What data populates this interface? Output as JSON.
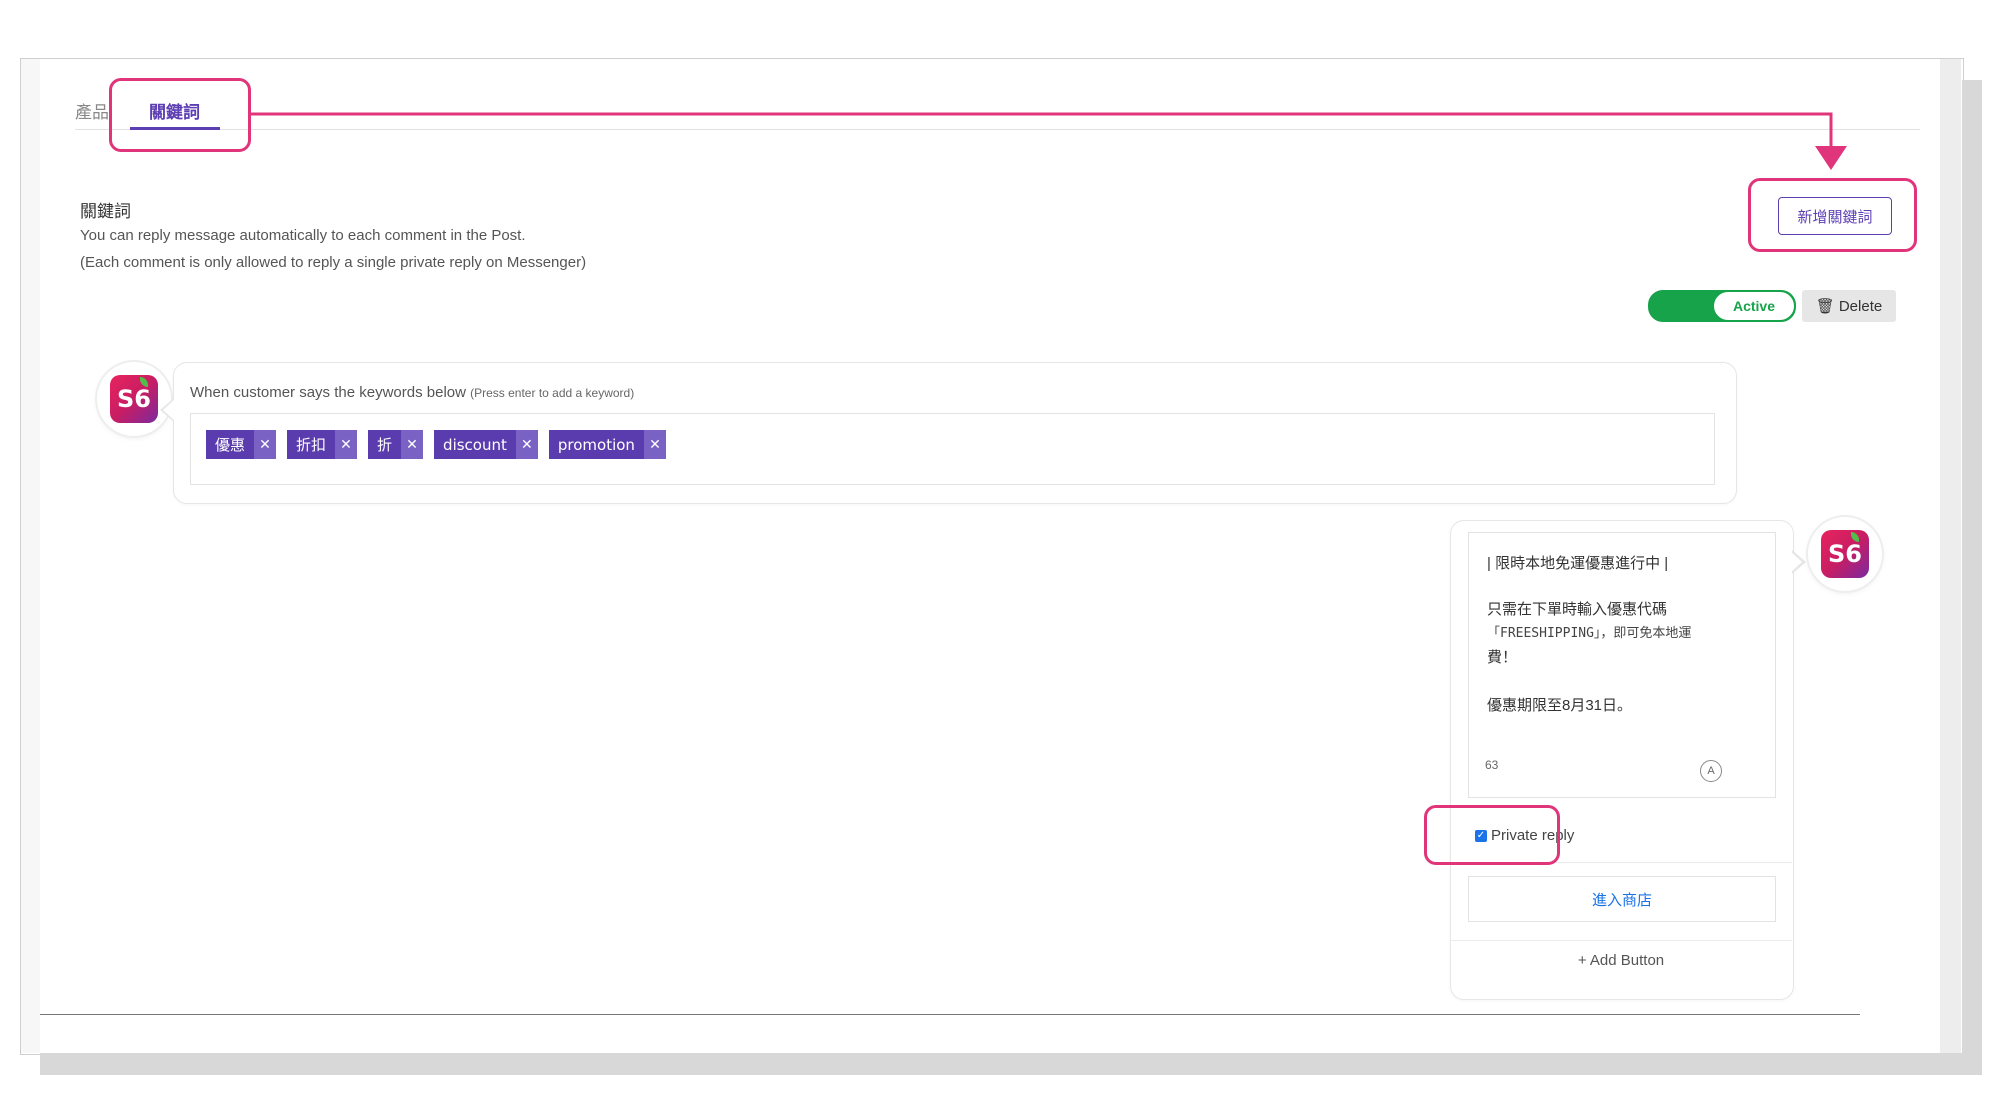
{
  "tabs": [
    {
      "label": "產品"
    },
    {
      "label": "關鍵詞"
    }
  ],
  "section": {
    "title": "關鍵詞",
    "description_line1": "You can reply message automatically to each comment in the Post.",
    "description_line2": "(Each comment is only allowed to reply a single private reply on Messenger)"
  },
  "add_keyword_button": "新增關鍵詞",
  "status_toggle": {
    "label": "Active",
    "state": "on"
  },
  "delete_button": "Delete",
  "keywords": {
    "label": "When customer says the keywords below",
    "hint": "(Press enter to add a keyword)",
    "tags": [
      "優惠",
      "折扣",
      "折",
      "discount",
      "promotion"
    ]
  },
  "reply": {
    "line1": "| 限時本地免運優惠進行中 |",
    "line2": "只需在下單時輸入優惠代碼",
    "line3": "「FREESHIPPING」，即可免本地運",
    "line4": "費！",
    "line5": "優惠期限至8月31日。",
    "char_count": "63",
    "private_reply_label": "Private reply",
    "private_reply_checked": true,
    "shop_button": "進入商店",
    "add_button": "+ Add Button"
  },
  "avatar_logo_text": "S6",
  "colors": {
    "accent": "#5e3fb3",
    "highlight": "#e0357a",
    "active_green": "#17a34a",
    "link_blue": "#1a73e8"
  }
}
